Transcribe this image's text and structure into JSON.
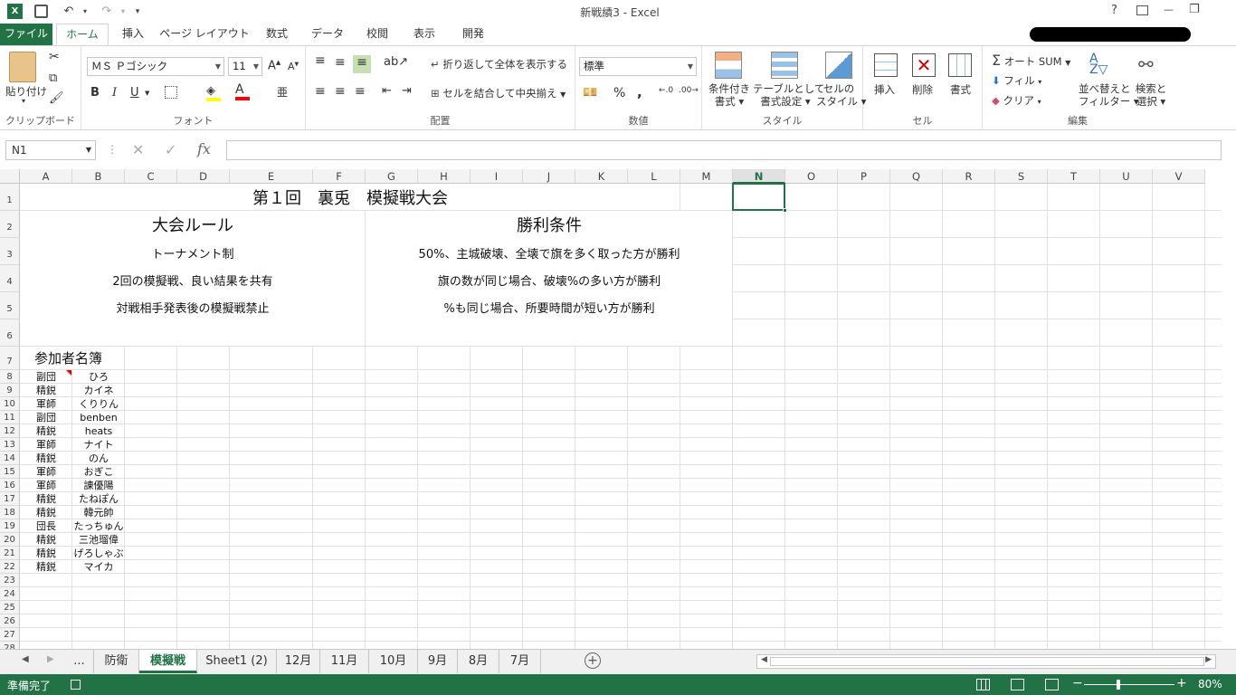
{
  "title": "新戦績3 - Excel",
  "quick_access": {
    "undo": "↶",
    "redo": "↷"
  },
  "window": {
    "help": "?",
    "min": "—",
    "restore": "❐"
  },
  "tabs": [
    "ファイル",
    "ホーム",
    "挿入",
    "ページ レイアウト",
    "数式",
    "データ",
    "校閲",
    "表示",
    "開発"
  ],
  "ribbon": {
    "clipboard": {
      "paste": "貼り付け",
      "label": "クリップボード"
    },
    "font": {
      "name": "ＭＳ Ｐゴシック",
      "size": "11",
      "bold": "B",
      "italic": "I",
      "underline": "U",
      "label": "フォント"
    },
    "align": {
      "wrap": "折り返して全体を表示する",
      "merge": "セルを結合して中央揃え",
      "label": "配置"
    },
    "number": {
      "format": "標準",
      "percent": "%",
      "comma": ",",
      "label": "数値"
    },
    "style": {
      "cond_line1": "条件付き",
      "cond_line2": "書式",
      "table_line1": "テーブルとして",
      "table_line2": "書式設定",
      "cell_line1": "セルの",
      "cell_line2": "スタイル",
      "label": "スタイル"
    },
    "cells": {
      "insert": "挿入",
      "delete": "削除",
      "format": "書式",
      "label": "セル"
    },
    "editing": {
      "autosum": "オート SUM",
      "fill": "フィル",
      "clear": "クリア",
      "sort_line1": "並べ替えと",
      "sort_line2": "フィルター",
      "find_line1": "検索と",
      "find_line2": "選択",
      "label": "編集"
    }
  },
  "name_box": "N1",
  "fx": "fx",
  "columns": [
    "A",
    "B",
    "C",
    "D",
    "E",
    "F",
    "G",
    "H",
    "I",
    "J",
    "K",
    "L",
    "M",
    "N",
    "O",
    "P",
    "Q",
    "R",
    "S",
    "T",
    "U",
    "V"
  ],
  "selected_column": "N",
  "rows": [
    "1",
    "2",
    "3",
    "4",
    "5",
    "6",
    "7",
    "8",
    "9",
    "10",
    "11",
    "12",
    "13",
    "14",
    "15",
    "16",
    "17",
    "18",
    "19",
    "20",
    "21",
    "22",
    "23",
    "24",
    "25",
    "26",
    "27",
    "28"
  ],
  "cells": {
    "title": "第１回　裏兎　模擬戦大会",
    "rules_header": "大会ルール",
    "win_header": "勝利条件",
    "rule1": "トーナメント制",
    "rule2": "2回の模擬戦、良い結果を共有",
    "rule3": "対戦相手発表後の模擬戦禁止",
    "win1": "50%、主城破壊、全壊で旗を多く取った方が勝利",
    "win2": "旗の数が同じ場合、破壊%の多い方が勝利",
    "win3": "%も同じ場合、所要時間が短い方が勝利",
    "roster_header": "参加者名簿"
  },
  "roster": [
    {
      "role": "副団",
      "name": "ひろ"
    },
    {
      "role": "精鋭",
      "name": "カイネ"
    },
    {
      "role": "軍師",
      "name": "くりりん"
    },
    {
      "role": "副団",
      "name": "benben"
    },
    {
      "role": "精鋭",
      "name": "heats"
    },
    {
      "role": "軍師",
      "name": "ナイト"
    },
    {
      "role": "精鋭",
      "name": "のん"
    },
    {
      "role": "軍師",
      "name": "おぎこ"
    },
    {
      "role": "軍師",
      "name": "諌優陽"
    },
    {
      "role": "精鋭",
      "name": "たねぽん"
    },
    {
      "role": "精鋭",
      "name": "韓元帥"
    },
    {
      "role": "団長",
      "name": "たっちゅん"
    },
    {
      "role": "精鋭",
      "name": "三池瑠偉"
    },
    {
      "role": "精鋭",
      "name": "げろしゃぶ"
    },
    {
      "role": "精鋭",
      "name": "マイカ"
    }
  ],
  "sheet_tabs": [
    "...",
    "防衛",
    "模擬戦",
    "Sheet1 (2)",
    "12月",
    "11月",
    "10月",
    "9月",
    "8月",
    "7月"
  ],
  "active_sheet": "模擬戦",
  "status": {
    "ready": "準備完了",
    "zoom": "80%"
  }
}
